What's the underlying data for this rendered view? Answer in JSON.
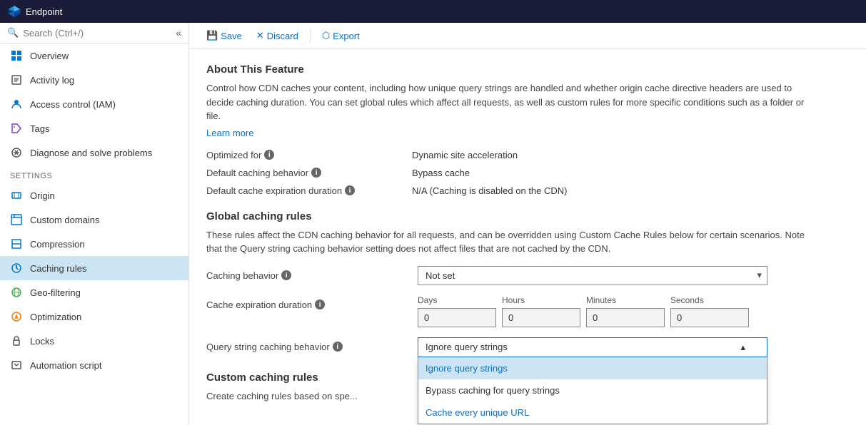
{
  "topbar": {
    "logo_label": "Endpoint"
  },
  "sidebar": {
    "search_placeholder": "Search (Ctrl+/)",
    "collapse_icon": "«",
    "nav_items": [
      {
        "id": "overview",
        "label": "Overview",
        "icon": "overview"
      },
      {
        "id": "activity-log",
        "label": "Activity log",
        "icon": "activity"
      },
      {
        "id": "iam",
        "label": "Access control (IAM)",
        "icon": "iam"
      },
      {
        "id": "tags",
        "label": "Tags",
        "icon": "tags"
      },
      {
        "id": "diagnose",
        "label": "Diagnose and solve problems",
        "icon": "diagnose"
      }
    ],
    "settings_label": "SETTINGS",
    "settings_items": [
      {
        "id": "origin",
        "label": "Origin",
        "icon": "origin"
      },
      {
        "id": "custom-domains",
        "label": "Custom domains",
        "icon": "domains"
      },
      {
        "id": "compression",
        "label": "Compression",
        "icon": "compression"
      },
      {
        "id": "caching-rules",
        "label": "Caching rules",
        "icon": "caching",
        "active": true
      },
      {
        "id": "geo-filtering",
        "label": "Geo-filtering",
        "icon": "geo"
      },
      {
        "id": "optimization",
        "label": "Optimization",
        "icon": "optim"
      },
      {
        "id": "locks",
        "label": "Locks",
        "icon": "locks"
      },
      {
        "id": "automation-script",
        "label": "Automation script",
        "icon": "auto"
      }
    ]
  },
  "toolbar": {
    "save_label": "Save",
    "discard_label": "Discard",
    "export_label": "Export"
  },
  "content": {
    "about_title": "About This Feature",
    "about_desc": "Control how CDN caches your content, including how unique query strings are handled and whether origin cache directive headers are used to decide caching duration. You can set global rules which affect all requests, as well as custom rules for more specific conditions such as a folder or file.",
    "learn_more": "Learn more",
    "optimized_for_label": "Optimized for",
    "optimized_for_value": "Dynamic site acceleration",
    "default_caching_label": "Default caching behavior",
    "default_caching_value": "Bypass cache",
    "default_expiry_label": "Default cache expiration duration",
    "default_expiry_value": "N/A (Caching is disabled on the CDN)",
    "global_rules_title": "Global caching rules",
    "global_rules_desc": "These rules affect the CDN caching behavior for all requests, and can be overridden using Custom Cache Rules below for certain scenarios. Note that the Query string caching behavior setting does not affect files that are not cached by the CDN.",
    "caching_behavior_label": "Caching behavior",
    "caching_behavior_value": "Not set",
    "cache_expiry_label": "Cache expiration duration",
    "cache_expiry_days_label": "Days",
    "cache_expiry_hours_label": "Hours",
    "cache_expiry_minutes_label": "Minutes",
    "cache_expiry_seconds_label": "Seconds",
    "cache_expiry_days_value": "0",
    "cache_expiry_hours_value": "0",
    "cache_expiry_minutes_value": "0",
    "cache_expiry_seconds_value": "0",
    "query_string_label": "Query string caching behavior",
    "query_string_selected": "Ignore query strings",
    "query_string_options": [
      {
        "id": "ignore",
        "label": "Ignore query strings",
        "selected": true
      },
      {
        "id": "bypass",
        "label": "Bypass caching for query strings",
        "selected": false
      },
      {
        "id": "unique",
        "label": "Cache every unique URL",
        "selected": false
      }
    ],
    "custom_rules_title": "Custom caching rules",
    "custom_rules_desc": "Create caching rules based on spe..."
  }
}
